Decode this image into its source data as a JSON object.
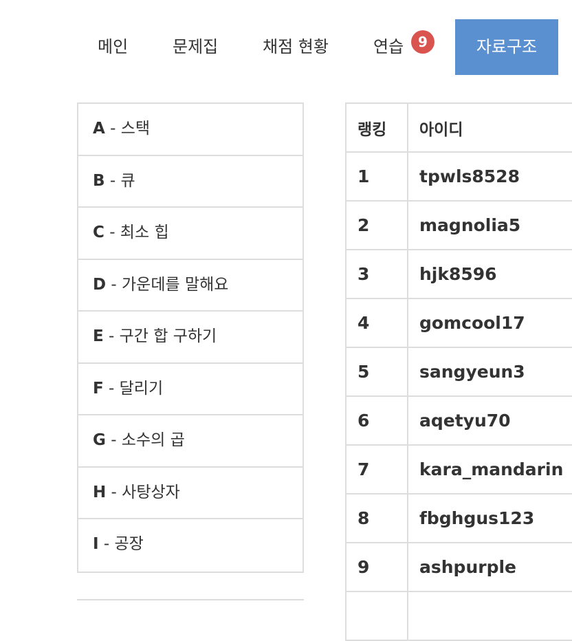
{
  "nav": {
    "items": [
      {
        "label": "메인"
      },
      {
        "label": "문제집"
      },
      {
        "label": "채점 현황"
      },
      {
        "label": "연습"
      }
    ],
    "practice_badge": "9",
    "active_label": "자료구조",
    "colors": {
      "active_bg": "#5a8fd0",
      "badge_bg": "#d9534f"
    }
  },
  "problems": [
    {
      "letter": "A",
      "title": " - 스택"
    },
    {
      "letter": "B",
      "title": " - 큐"
    },
    {
      "letter": "C",
      "title": " - 최소 힙"
    },
    {
      "letter": "D",
      "title": " - 가운데를 말해요"
    },
    {
      "letter": "E",
      "title": " - 구간 합 구하기"
    },
    {
      "letter": "F",
      "title": " - 달리기"
    },
    {
      "letter": "G",
      "title": " - 소수의 곱"
    },
    {
      "letter": "H",
      "title": " - 사탕상자"
    },
    {
      "letter": "I",
      "title": " - 공장"
    }
  ],
  "ranking": {
    "headers": [
      "랭킹",
      "아이디"
    ],
    "rows": [
      {
        "rank": "1",
        "id": "tpwls8528"
      },
      {
        "rank": "2",
        "id": "magnolia5"
      },
      {
        "rank": "3",
        "id": "hjk8596"
      },
      {
        "rank": "4",
        "id": "gomcool17"
      },
      {
        "rank": "5",
        "id": "sangyeun3"
      },
      {
        "rank": "6",
        "id": "aqetyu70"
      },
      {
        "rank": "7",
        "id": "kara_mandarin"
      },
      {
        "rank": "8",
        "id": "fbghgus123"
      },
      {
        "rank": "9",
        "id": "ashpurple"
      }
    ]
  }
}
